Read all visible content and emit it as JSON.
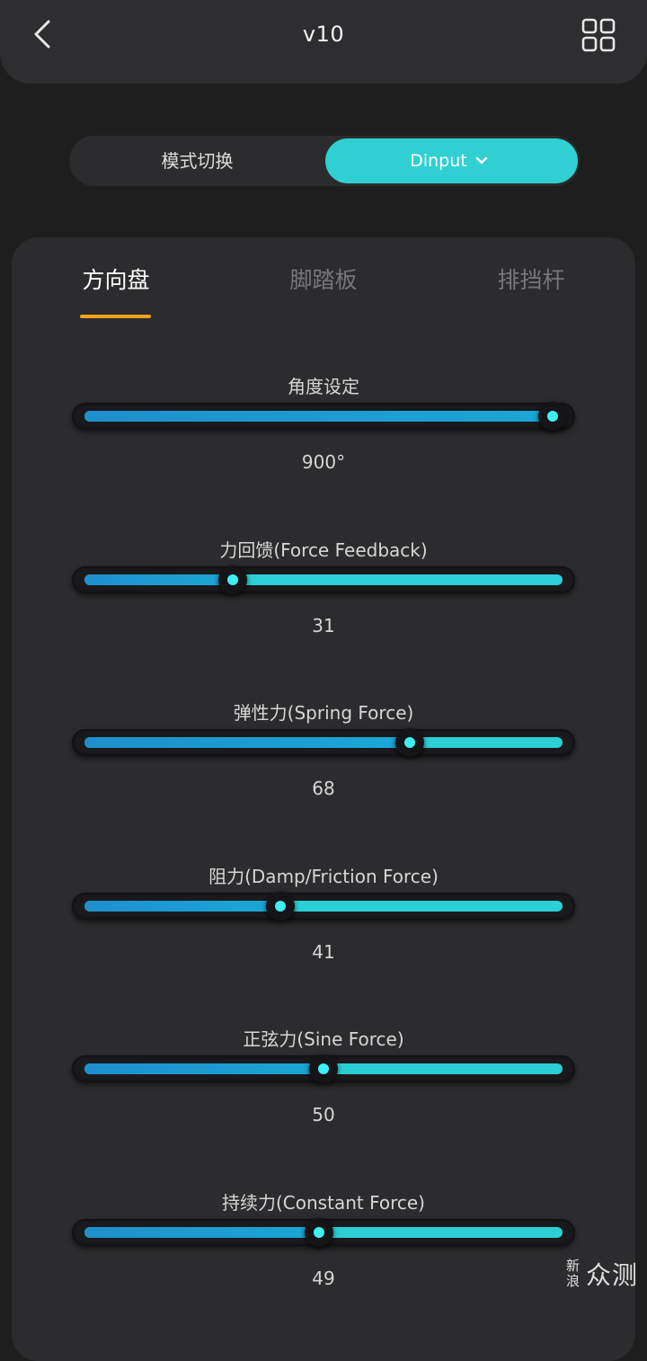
{
  "header": {
    "title": "v10",
    "back_icon": "chevron-left-icon",
    "menu_icon": "grid-icon"
  },
  "mode": {
    "label": "模式切换",
    "selected": "Dinput",
    "accent": "#30d0d2"
  },
  "tabs": [
    {
      "label": "方向盘",
      "active": true
    },
    {
      "label": "脚踏板",
      "active": false
    },
    {
      "label": "排挡杆",
      "active": false
    }
  ],
  "settings": [
    {
      "label": "角度设定",
      "value_text": "900°",
      "fraction": 0.98
    },
    {
      "label": "力回馈(Force Feedback)",
      "value_text": "31",
      "fraction": 0.31
    },
    {
      "label": "弹性力(Spring Force)",
      "value_text": "68",
      "fraction": 0.68
    },
    {
      "label": "阻力(Damp/Friction Force)",
      "value_text": "41",
      "fraction": 0.41
    },
    {
      "label": "正弦力(Sine Force)",
      "value_text": "50",
      "fraction": 0.5
    },
    {
      "label": "持续力(Constant Force)",
      "value_text": "49",
      "fraction": 0.49
    }
  ],
  "colors": {
    "tab_underline": "#f0a21d",
    "slider_fill": "#1f8fcc",
    "slider_track": "#2dcfd6",
    "thumb_dot": "#3df0f4"
  },
  "watermark": {
    "small": "新浪",
    "big": "众测"
  }
}
